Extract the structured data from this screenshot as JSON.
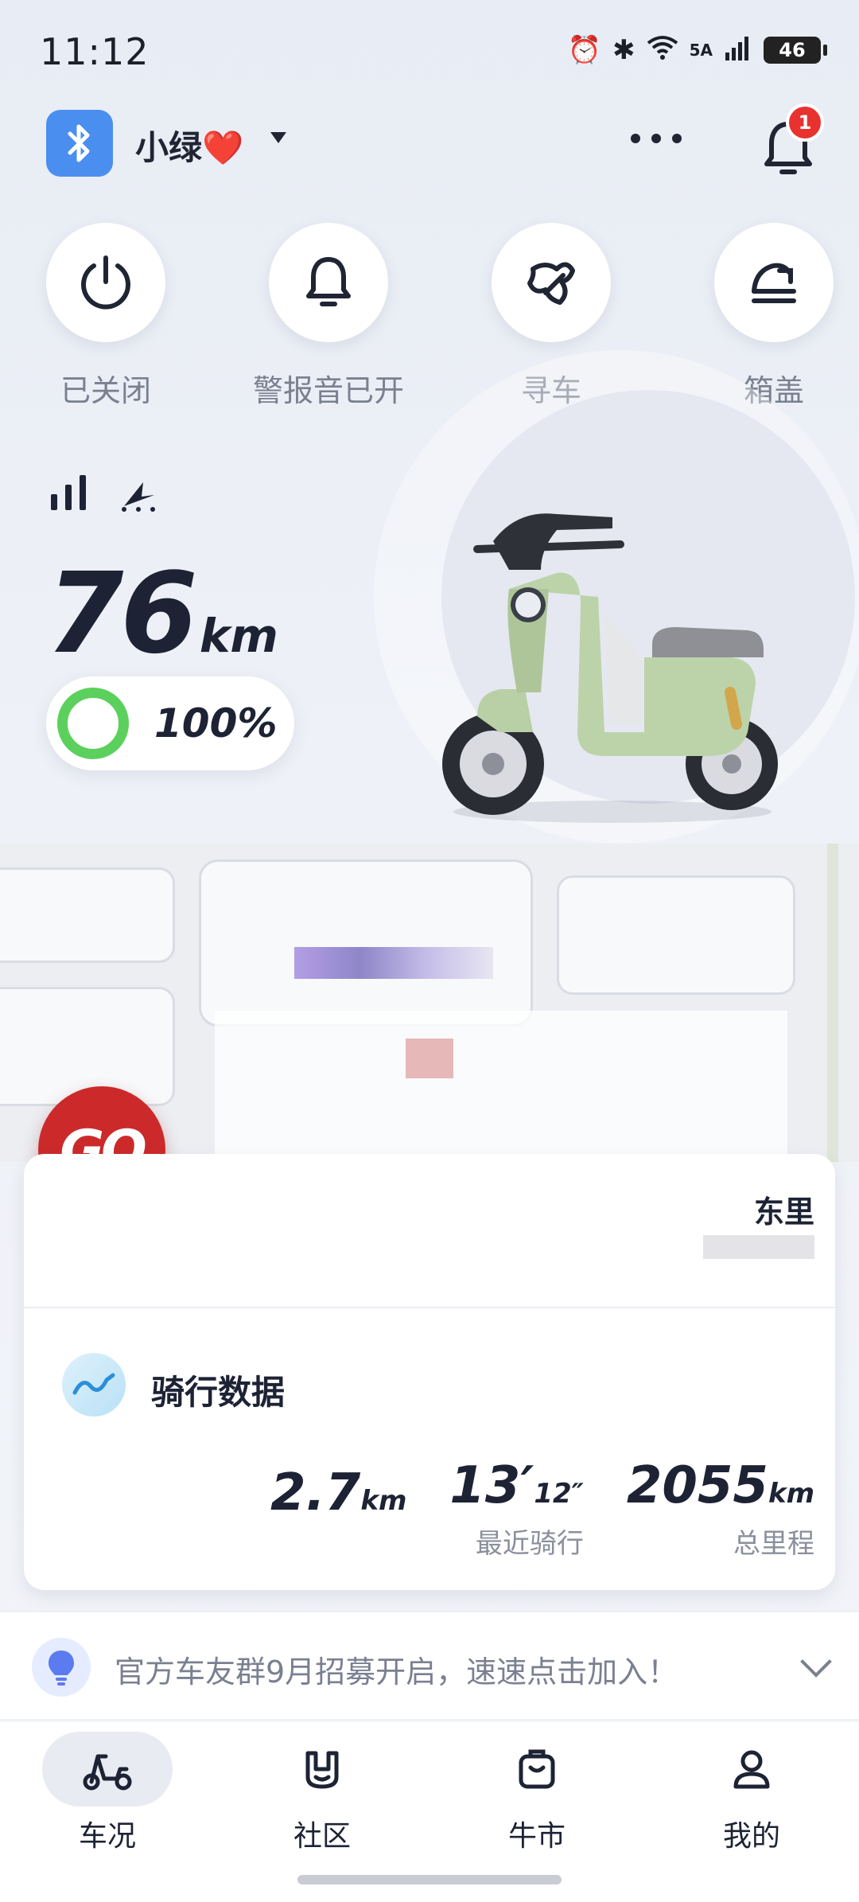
{
  "status_bar": {
    "time": "11:12",
    "network": "5A",
    "battery": "46"
  },
  "header": {
    "device_name": "小绿❤️",
    "notification_count": "1"
  },
  "quick_actions": [
    {
      "label": "已关闭",
      "icon": "power-icon"
    },
    {
      "label": "警报音已开",
      "icon": "bell-icon"
    },
    {
      "label": "寻车",
      "icon": "find-vehicle-icon"
    },
    {
      "label": "箱盖",
      "icon": "trunk-lid-icon"
    }
  ],
  "vehicle": {
    "range_value": "76",
    "range_unit": "km",
    "battery_percent": "100%",
    "battery_fraction": 1.0
  },
  "location": {
    "address": "东里"
  },
  "go_button": {
    "label": "GO"
  },
  "ride_data": {
    "title": "骑行数据",
    "stats": [
      {
        "value": "2.7",
        "unit": "km",
        "label": ""
      },
      {
        "value": "13′",
        "unit": "12″",
        "label": "最近骑行"
      },
      {
        "value": "2055",
        "unit": "km",
        "label": "总里程"
      }
    ]
  },
  "notice": {
    "text": "官方车友群9月招募开启，速速点击加入！"
  },
  "tabbar": [
    {
      "label": "车况",
      "icon": "scooter-tab-icon",
      "active": true
    },
    {
      "label": "社区",
      "icon": "community-tab-icon",
      "active": false
    },
    {
      "label": "牛市",
      "icon": "shop-tab-icon",
      "active": false
    },
    {
      "label": "我的",
      "icon": "profile-tab-icon",
      "active": false
    }
  ],
  "colors": {
    "accent_red": "#cc2a2a",
    "battery_green": "#5cd05c",
    "bluetooth_blue": "#4a8ff0",
    "badge_red": "#e8322f"
  }
}
